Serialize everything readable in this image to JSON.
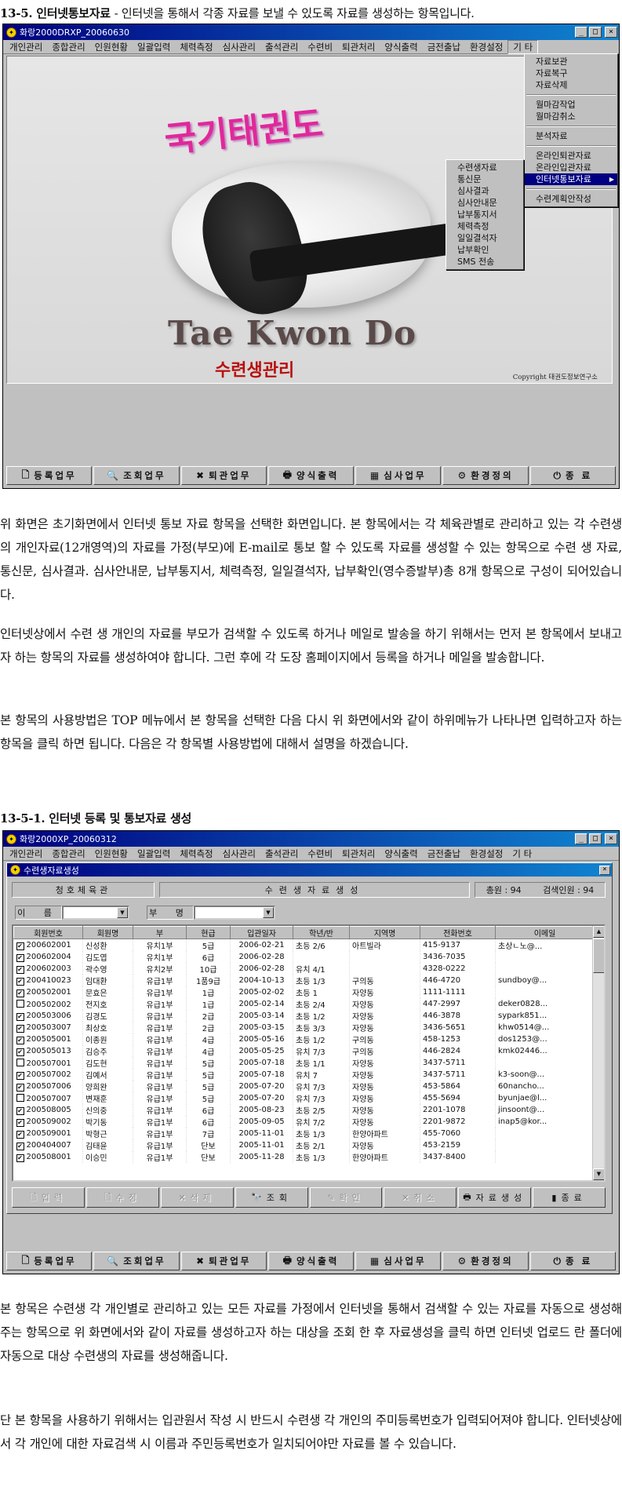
{
  "section1": {
    "number": "13-5.",
    "title": "인터넷통보자료",
    "description": "- 인터넷을 통해서 각종 자료를 보낼 수 있도록 자료를 생성하는 항목입니다."
  },
  "window1": {
    "title": "화랑2000DRXP_20060630",
    "menu": [
      "개인관리",
      "종합관리",
      "인원현황",
      "일괄입력",
      "체력측정",
      "심사관리",
      "출석관리",
      "수련비",
      "퇴관처리",
      "양식출력",
      "금전출납",
      "환경설정",
      "기 타"
    ],
    "splash": {
      "logo_korean": "국기태권도",
      "logo_english": "Tae Kwon Do",
      "subtitle": "수련생관리",
      "copyright": "Copyright  태권도정보연구소"
    },
    "main_dropdown": [
      "자료보관",
      "자료복구",
      "자료삭제",
      "---",
      "월마감작업",
      "월마감취소",
      "---",
      "분석자료",
      "---",
      "온라인퇴관자료",
      "온라인입관자료",
      "인터넷통보자료",
      "---",
      "수련계획안작성"
    ],
    "highlighted_item": "인터넷통보자료",
    "sub_dropdown": [
      "수련생자료",
      "통신문",
      "심사결과",
      "심사안내문",
      "납부통지서",
      "체력측정",
      "일일결석자",
      "납부확인",
      "SMS 전송"
    ]
  },
  "toolbar": [
    {
      "icon": "document-icon",
      "glyph": "🗋",
      "label": "등록업무"
    },
    {
      "icon": "search-icon",
      "glyph": "🔍",
      "label": "조회업무"
    },
    {
      "icon": "x-icon",
      "glyph": "✖",
      "label": "퇴관업무"
    },
    {
      "icon": "printer-icon",
      "glyph": "🖶",
      "label": "양식출력"
    },
    {
      "icon": "exam-icon",
      "glyph": "▦",
      "label": "심사업무"
    },
    {
      "icon": "settings-icon",
      "glyph": "⚙",
      "label": "환경정의"
    },
    {
      "icon": "exit-icon",
      "glyph": "⏻",
      "label": "종      료"
    }
  ],
  "paragraphs": [
    "위 화면은 초기화면에서 인터넷 통보 자료 항목을 선택한 화면입니다. 본 항목에서는 각 체육관별로 관리하고 있는 각 수련생의 개인자료(12개영역)의 자료를 가정(부모)에 E-mail로 통보 할 수 있도록 자료를 생성할 수 있는 항목으로 수련 생 자료, 통신문, 심사결과. 심사안내문, 납부통지서, 체력측정, 일일결석자, 납부확인(영수증발부)총 8개 항목으로 구성이 되어있습니다.",
    "인터넷상에서 수련 생 개인의 자료를 부모가 검색할 수 있도록 하거나 메일로 발송을 하기 위해서는 먼저 본 항목에서 보내고자 하는 항목의 자료를 생성하여야 합니다. 그런 후에 각 도장 홈페이지에서 등록을 하거나 메일을 발송합니다.",
    "본 항목의 사용방법은 TOP 메뉴에서 본 항목을 선택한 다음 다시 위 화면에서와 같이 하위메뉴가 나타나면 입력하고자 하는 항목을 클릭 하면 됩니다. 다음은 각 항목별 사용방법에 대해서 설명을 하겠습니다."
  ],
  "section2": {
    "number": "13-5-1.",
    "title": "인터넷 등록 및 통보자료 생성"
  },
  "window2": {
    "title": "화랑2000XP_20060312",
    "inner_title": "수련생자료생성",
    "dojang": "청호체육관",
    "form_title": "수련생자료생성",
    "total": "총원 : 94",
    "search_count": "검색인원 : 94",
    "name_label": "이 름",
    "parent_label": "부 명",
    "columns": [
      "회원번호",
      "회원명",
      "부",
      "현급",
      "입관일자",
      "학년/반",
      "지역명",
      "전화번호",
      "이메일"
    ],
    "rows": [
      [
        "200602001",
        "신성환",
        "유치1부",
        "5급",
        "2006-02-21",
        "초등 2/6",
        "아트빌라",
        "415-9137",
        "초상ㄴ노@..."
      ],
      [
        "200602004",
        "김도엽",
        "유치1부",
        "6급",
        "2006-02-28",
        "",
        "",
        "3436-7035",
        ""
      ],
      [
        "200602003",
        "곽수영",
        "유치2부",
        "10급",
        "2006-02-28",
        "유치 4/1",
        "",
        "4328-0222",
        ""
      ],
      [
        "200410023",
        "임대환",
        "유급1부",
        "1품9급",
        "2004-10-13",
        "초등 1/3",
        "구의동",
        "446-4720",
        "sundboy@..."
      ],
      [
        "200502001",
        "문효은",
        "유급1부",
        "1급",
        "2005-02-02",
        "초등 1",
        "자양동",
        "1111-1111",
        ""
      ],
      [
        "200502002",
        "전지호",
        "유급1부",
        "1급",
        "2005-02-14",
        "초등 2/4",
        "자양동",
        "447-2997",
        "deker0828..."
      ],
      [
        "200503006",
        "김경도",
        "유급1부",
        "2급",
        "2005-03-14",
        "초등 1/2",
        "자양동",
        "446-3878",
        "sypark851..."
      ],
      [
        "200503007",
        "최상호",
        "유급1부",
        "2급",
        "2005-03-15",
        "초등 3/3",
        "자양동",
        "3436-5651",
        "khw0514@..."
      ],
      [
        "200505001",
        "이종원",
        "유급1부",
        "4급",
        "2005-05-16",
        "초등 1/2",
        "구의동",
        "458-1253",
        "dos1253@..."
      ],
      [
        "200505013",
        "김승주",
        "유급1부",
        "4급",
        "2005-05-25",
        "유치 7/3",
        "구의동",
        "446-2824",
        "kmk02446..."
      ],
      [
        "200507001",
        "김도현",
        "유급1부",
        "5급",
        "2005-07-18",
        "초등 1/1",
        "자양동",
        "3437-5711",
        ""
      ],
      [
        "200507002",
        "김예서",
        "유급1부",
        "5급",
        "2005-07-18",
        "유치 7",
        "자양동",
        "3437-5711",
        "k3-soon@..."
      ],
      [
        "200507006",
        "양희완",
        "유급1부",
        "5급",
        "2005-07-20",
        "유치 7/3",
        "자양동",
        "453-5864",
        "60nancho..."
      ],
      [
        "200507007",
        "변재훈",
        "유급1부",
        "5급",
        "2005-07-20",
        "유치 7/3",
        "자양동",
        "455-5694",
        "byunjae@l..."
      ],
      [
        "200508005",
        "신의중",
        "유급1부",
        "6급",
        "2005-08-23",
        "초등 2/5",
        "자양동",
        "2201-1078",
        "jinsoont@..."
      ],
      [
        "200509002",
        "박기동",
        "유급1부",
        "6급",
        "2005-09-05",
        "유치 7/2",
        "자양동",
        "2201-9872",
        "inap5@kor..."
      ],
      [
        "200509001",
        "박형근",
        "유급1부",
        "7급",
        "2005-11-01",
        "초등 1/3",
        "한양아파트",
        "455-7060",
        ""
      ],
      [
        "200404007",
        "김태윤",
        "유급1부",
        "단보",
        "2005-11-01",
        "초등 2/1",
        "자양동",
        "453-2159",
        ""
      ],
      [
        "200508001",
        "이승민",
        "유급1부",
        "단보",
        "2005-11-28",
        "초등 1/3",
        "한양아파트",
        "3437-8400",
        ""
      ]
    ],
    "checked": [
      true,
      true,
      true,
      true,
      true,
      false,
      true,
      true,
      true,
      true,
      false,
      true,
      true,
      false,
      true,
      true,
      true,
      true,
      true
    ],
    "form_buttons": [
      {
        "icon": "new-icon",
        "glyph": "🗋",
        "label": "입력",
        "enabled": false
      },
      {
        "icon": "edit-icon",
        "glyph": "🗋",
        "label": "수정",
        "enabled": false
      },
      {
        "icon": "delete-icon",
        "glyph": "✕",
        "label": "삭제",
        "enabled": false
      },
      {
        "icon": "binoculars-icon",
        "glyph": "🔭",
        "label": "조회",
        "enabled": true
      },
      {
        "icon": "confirm-icon",
        "glyph": "✎",
        "label": "확인",
        "enabled": false
      },
      {
        "icon": "cancel-icon",
        "glyph": "✕",
        "label": "취소",
        "enabled": false
      },
      {
        "icon": "generate-icon",
        "glyph": "🖶",
        "label": "자료생성",
        "enabled": true
      },
      {
        "icon": "exit-icon",
        "glyph": "▮",
        "label": "종료",
        "enabled": true
      }
    ]
  },
  "paragraphs2": [
    "본 항목은 수련생 각 개인별로 관리하고 있는 모든 자료를 가정에서 인터넷을 통해서 검색할 수 있는 자료를 자동으로 생성해 주는 항목으로 위 화면에서와 같이 자료를 생성하고자 하는 대상을 조회 한 후 자료생성을 클릭 하면 인터넷 업로드 란 폴더에 자동으로 대상 수련생의 자료를 생성해줍니다.",
    "단 본 항목을 사용하기 위해서는 입관원서 작성 시 반드시 수련생 각 개인의 주미등록번호가 입력되어져야 합니다. 인터넷상에서 각 개인에 대한 자료검색 시 이름과 주민등록번호가 일치되어야만 자료를 볼 수 있습니다."
  ]
}
